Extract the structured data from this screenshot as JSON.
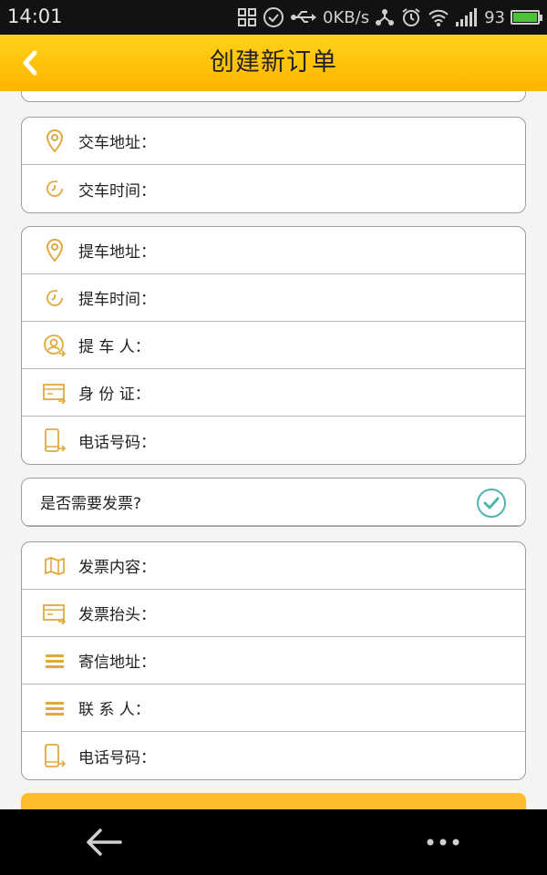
{
  "status_bar": {
    "time": "14:01",
    "net_speed": "0KB/s",
    "battery": "93",
    "icons": [
      "qr-icon",
      "check-circle-icon",
      "usb-icon",
      "network-icon",
      "alarm-icon",
      "wifi-icon",
      "signal-icon",
      "battery-icon"
    ]
  },
  "header": {
    "title": "创建新订单",
    "back_icon": "chevron-left-icon"
  },
  "sections": {
    "delivery": {
      "address_label": "交车地址：",
      "time_label": "交车时间："
    },
    "pickup": {
      "address_label": "提车地址：",
      "time_label": "提车时间：",
      "person_label": "提 车 人：",
      "id_label": "身 份 证：",
      "phone_label": "电话号码："
    },
    "invoice_toggle": {
      "label": "是否需要发票?",
      "checked": true
    },
    "invoice": {
      "content_label": "发票内容：",
      "title_label": "发票抬头：",
      "address_label": "寄信地址：",
      "contact_label": "联 系 人：",
      "phone_label": "电话号码："
    }
  },
  "colors": {
    "accent": "#FFC20E",
    "header_top": "#FFD21A",
    "header_bottom": "#FFB400",
    "icon": "#E2A93A",
    "check": "#4DB6AC"
  },
  "nav_bar": {
    "icons": [
      "back-arrow-icon",
      "more-dots-icon"
    ]
  }
}
